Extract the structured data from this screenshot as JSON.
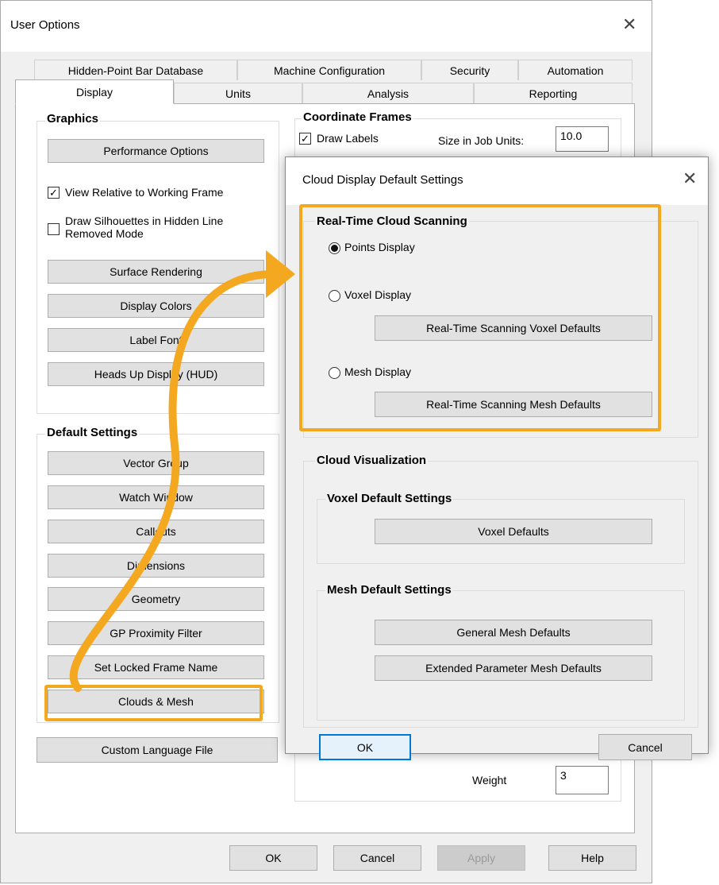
{
  "main": {
    "title": "User Options",
    "tabs_row1": [
      "Hidden-Point Bar Database",
      "Machine Configuration",
      "Security",
      "Automation"
    ],
    "tabs_row2": [
      "Display",
      "Units",
      "Analysis",
      "Reporting"
    ],
    "graphics": {
      "label": "Graphics",
      "performance": "Performance Options",
      "view_relative": "View Relative to Working Frame",
      "draw_silhouettes_1": "Draw Silhouettes in Hidden Line",
      "draw_silhouettes_2": "Removed Mode",
      "surface_rendering": "Surface Rendering",
      "display_colors": "Display Colors",
      "label_font": "Label Font",
      "hud": "Heads Up Display (HUD)"
    },
    "defaults": {
      "label": "Default Settings",
      "buttons": [
        "Vector Group",
        "Watch Window",
        "Callouts",
        "Dimensions",
        "Geometry",
        "GP Proximity Filter",
        "Set Locked Frame Name",
        "Clouds & Mesh"
      ]
    },
    "custom_language": "Custom Language File",
    "coord": {
      "label": "Coordinate Frames",
      "draw_labels": "Draw Labels",
      "size_label": "Size in Job Units:",
      "size_value": "10.0"
    },
    "weight_label": "Weight",
    "weight_value": "3",
    "footer": {
      "ok": "OK",
      "cancel": "Cancel",
      "apply": "Apply",
      "help": "Help"
    }
  },
  "dialog": {
    "title": "Cloud Display Default Settings",
    "realtime": {
      "label": "Real-Time Cloud Scanning",
      "points": "Points Display",
      "voxel": "Voxel Display",
      "voxel_defaults": "Real-Time Scanning Voxel Defaults",
      "mesh": "Mesh Display",
      "mesh_defaults": "Real-Time Scanning Mesh Defaults",
      "selected": "points"
    },
    "visualization": {
      "label": "Cloud Visualization",
      "voxel_group": "Voxel Default Settings",
      "voxel_defaults": "Voxel Defaults",
      "mesh_group": "Mesh Default Settings",
      "general_mesh": "General Mesh Defaults",
      "extended_mesh": "Extended Parameter Mesh Defaults"
    },
    "ok": "OK",
    "cancel": "Cancel"
  },
  "colors": {
    "highlight": "#f4a820",
    "focus": "#0078d7"
  }
}
